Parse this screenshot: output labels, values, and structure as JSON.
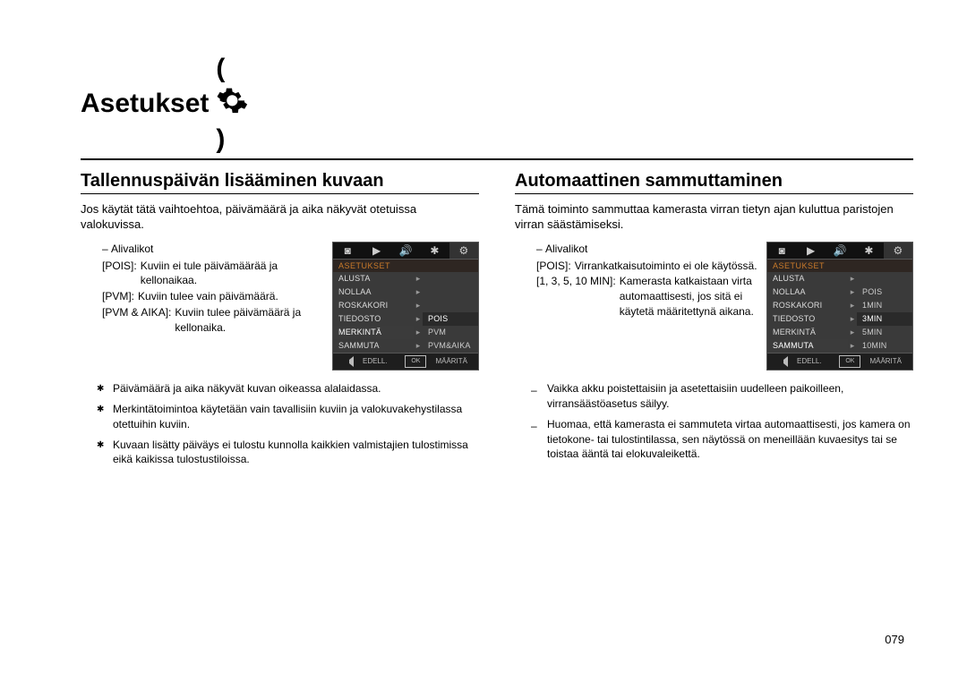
{
  "page_title": "Asetukset",
  "page_number": "079",
  "left": {
    "heading": "Tallennuspäivän lisääminen kuvaan",
    "intro": "Jos käytät tätä vaihtoehtoa, päivämäärä ja aika näkyvät otetuissa valokuvissa.",
    "sub_label": "Alivalikot",
    "defs": [
      {
        "k": "[POIS]:",
        "v": "Kuviin ei tule päivämäärää ja kellonaikaa."
      },
      {
        "k": "[PVM]:",
        "v": "Kuviin tulee vain päivämäärä."
      },
      {
        "k": "[PVM & AIKA]:",
        "v": "Kuviin tulee päivämäärä ja kellonaika."
      }
    ],
    "menu": {
      "header": "ASETUKSET",
      "items": [
        "ALUSTA",
        "NOLLAA",
        "ROSKAKORI",
        "TIEDOSTO",
        "MERKINTÄ",
        "SAMMUTA"
      ],
      "hl_index": 4,
      "options": [
        "POIS",
        "PVM",
        "PVM&AIKA"
      ],
      "opt_hl": 0,
      "foot_left": "EDELL.",
      "foot_right": "MÄÄRITÄ"
    },
    "notes": [
      "Päivämäärä ja aika näkyvät kuvan oikeassa alalaidassa.",
      "Merkintätoimintoa käytetään vain tavallisiin kuviin ja valokuvakehystilassa otettuihin kuviin.",
      "Kuvaan lisätty päiväys ei tulostu kunnolla kaikkien valmistajien tulostimissa eikä kaikissa tulostustiloissa."
    ]
  },
  "right": {
    "heading": "Automaattinen sammuttaminen",
    "intro": "Tämä toiminto sammuttaa kamerasta virran tietyn ajan kuluttua paristojen virran säästämiseksi.",
    "sub_label": "Alivalikot",
    "defs": [
      {
        "k": "[POIS]:",
        "v": "Virrankatkaisutoiminto ei ole käytössä."
      },
      {
        "k": "[1, 3, 5, 10 MIN]:",
        "v": "Kamerasta katkaistaan virta automaattisesti, jos sitä ei käytetä määritettynä aikana."
      }
    ],
    "menu": {
      "header": "ASETUKSET",
      "items": [
        "ALUSTA",
        "NOLLAA",
        "ROSKAKORI",
        "TIEDOSTO",
        "MERKINTÄ",
        "SAMMUTA"
      ],
      "hl_index": 5,
      "options": [
        "POIS",
        "1MIN",
        "3MIN",
        "5MIN",
        "10MIN"
      ],
      "opt_hl": 2,
      "foot_left": "EDELL.",
      "foot_right": "MÄÄRITÄ"
    },
    "notes": [
      "Vaikka akku poistettaisiin ja asetettaisiin uudelleen paikoilleen, virransäästöasetus säilyy.",
      "Huomaa, että kamerasta ei sammuteta virtaa automaattisesti, jos kamera on tietokone- tai tulostintilassa, sen näytössä on meneillään kuvaesitys tai se toistaa ääntä tai elokuvaleikettä."
    ]
  }
}
